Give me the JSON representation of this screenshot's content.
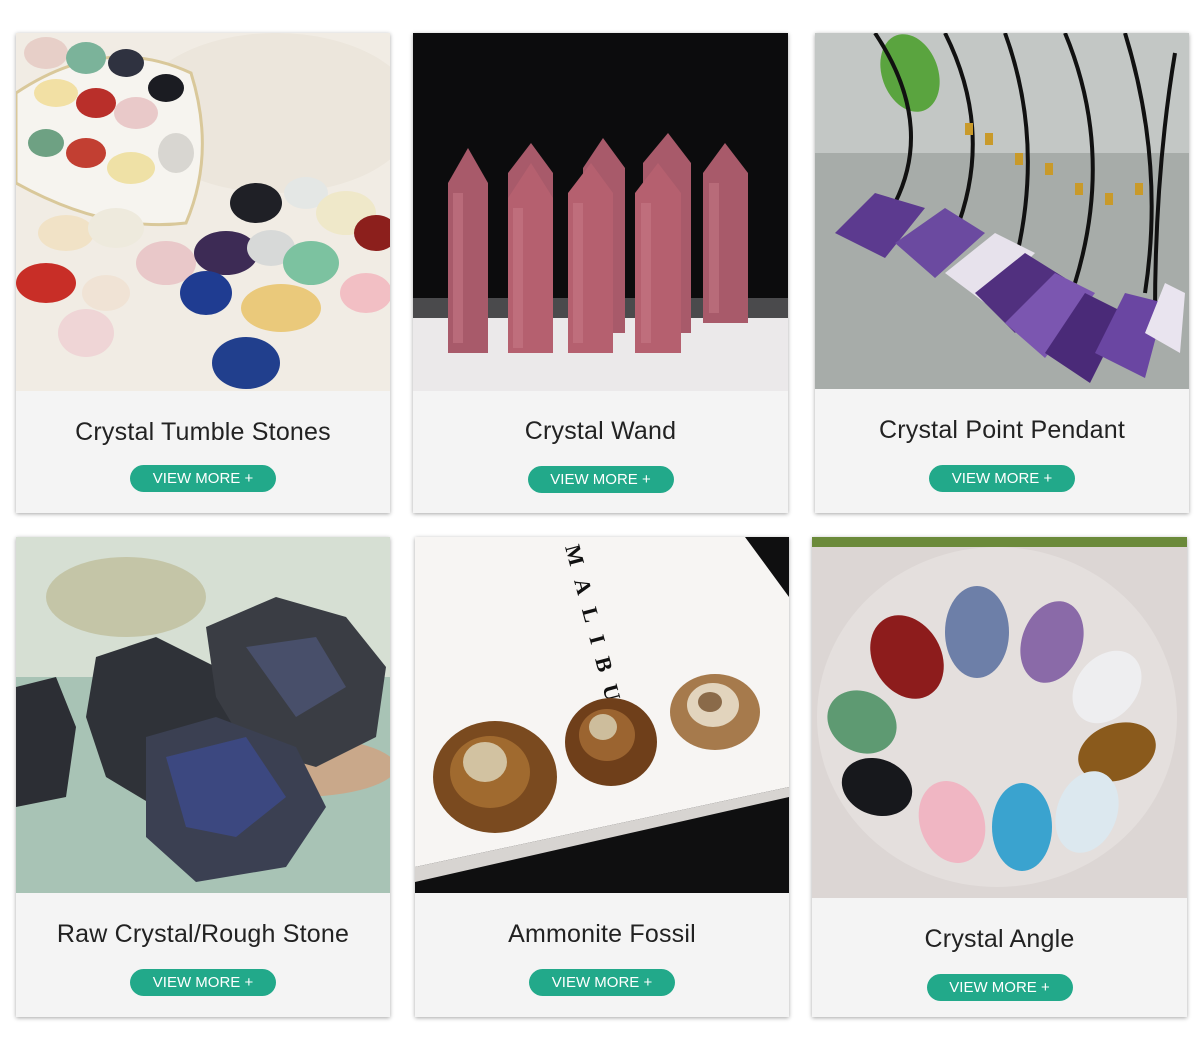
{
  "products": [
    {
      "title": "Crystal Tumble Stones",
      "button": "VIEW MORE +",
      "image": "tumble-stones-photo"
    },
    {
      "title": "Crystal Wand",
      "button": "VIEW MORE +",
      "image": "crystal-wand-photo"
    },
    {
      "title": "Crystal Point Pendant",
      "button": "VIEW MORE +",
      "image": "point-pendant-photo"
    },
    {
      "title": "Raw Crystal/Rough Stone",
      "button": "VIEW MORE +",
      "image": "rough-stone-photo"
    },
    {
      "title": "Ammonite Fossil",
      "button": "VIEW MORE +",
      "image": "ammonite-fossil-photo"
    },
    {
      "title": "Crystal Angle",
      "button": "VIEW MORE +",
      "image": "crystal-angel-photo"
    }
  ],
  "fossil_photo_text": {
    "letters": "MALIBU"
  },
  "colors": {
    "button_bg": "#22a98a",
    "card_bg": "#f4f4f4",
    "title_text": "#222222"
  }
}
